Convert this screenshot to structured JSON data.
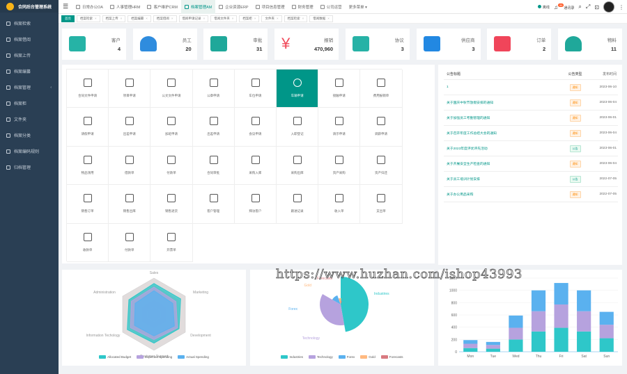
{
  "app": {
    "title": "合同后台管理系统"
  },
  "sidebar": {
    "items": [
      {
        "label": "档案检索",
        "arrow": ""
      },
      {
        "label": "档案借阅",
        "arrow": ""
      },
      {
        "label": "档案上传",
        "arrow": ""
      },
      {
        "label": "档案编纂",
        "arrow": ""
      },
      {
        "label": "档案管理",
        "arrow": "‹"
      },
      {
        "label": "档案柜",
        "arrow": ""
      },
      {
        "label": "文件夹",
        "arrow": ""
      },
      {
        "label": "档案分类",
        "arrow": ""
      },
      {
        "label": "档案编码规则",
        "arrow": ""
      },
      {
        "label": "归档管理",
        "arrow": ""
      }
    ]
  },
  "topbar": {
    "modules": [
      "日常办公OA",
      "人事管理HRM",
      "客户维护CRM",
      "档案管理AM",
      "企业资源ERP",
      "项目信息管理",
      "财务管理",
      "公司运营"
    ],
    "more": "更多菜单 ▾",
    "user_status": "离线",
    "notify_label": "通讯录",
    "notify_count": "99"
  },
  "tabs": [
    "首页",
    "档案检索",
    "档案上传",
    "档案编纂",
    "档案借阅",
    "借阅申请记录",
    "借阅文件夹",
    "档案柜",
    "文件夹",
    "档案检索",
    "借阅数据"
  ],
  "stats": [
    {
      "label": "客户",
      "value": "4",
      "color": "#26b3a6",
      "icon": "users-icon"
    },
    {
      "label": "员工",
      "value": "20",
      "color": "#2f8cde",
      "icon": "user-icon"
    },
    {
      "label": "审批",
      "value": "31",
      "color": "#1fa89a",
      "icon": "card-icon"
    },
    {
      "label": "报销",
      "value": "470,960",
      "color": "#f04b5b",
      "icon": "yen-icon"
    },
    {
      "label": "协议",
      "value": "3",
      "color": "#27b2a6",
      "icon": "contract-icon"
    },
    {
      "label": "供应商",
      "value": "3",
      "color": "#2288e2",
      "icon": "supplier-icon"
    },
    {
      "label": "订单",
      "value": "2",
      "color": "#f0455a",
      "icon": "calendar-icon"
    },
    {
      "label": "物料",
      "value": "11",
      "color": "#1fa89a",
      "icon": "gauge-icon"
    }
  ],
  "grid": [
    "合同文件申请",
    "项目申请",
    "公文文件申请",
    "公章申请",
    "车位申请",
    "车辆申请",
    "接触申请",
    "费用报销单",
    "请假申请",
    "出差申请",
    "加班申请",
    "出差申请",
    "会议申请",
    "入职登记",
    "请示申请",
    "调薪申请",
    "物品领用",
    "借款单",
    "付款单",
    "合同审批",
    "采购入库",
    "采购出库",
    "资产采购",
    "资产归还",
    "销售订单",
    "销售出库",
    "销售退货",
    "客户管理",
    "拜访客户",
    "跟进记录",
    "收入单",
    "支出单",
    "收款单",
    "付款单",
    "开票单"
  ],
  "notice": {
    "headers": [
      "公告标题",
      "公告类型",
      "发布时间"
    ],
    "rows": [
      {
        "title": "1",
        "type": "通知",
        "kind": "o",
        "date": "2023-06-10"
      },
      {
        "title": "关于国庆中秋节放假安排的通知",
        "type": "通知",
        "kind": "o",
        "date": "2023-06-04"
      },
      {
        "title": "关于加强员工考勤管理的通知",
        "type": "通知",
        "kind": "o",
        "date": "2023-06-01"
      },
      {
        "title": "关于召开年度工作总结大会的通知",
        "type": "通知",
        "kind": "o",
        "date": "2023-06-04"
      },
      {
        "title": "关于2023年度评优评先活动",
        "type": "公告",
        "kind": "g",
        "date": "2023-06-01"
      },
      {
        "title": "关于开展安全生产检查的通知",
        "type": "通知",
        "kind": "o",
        "date": "2023-06-04"
      },
      {
        "title": "关于员工培训计划安排",
        "type": "公告",
        "kind": "g",
        "date": "2022-07-05"
      },
      {
        "title": "关于办公用品采购",
        "type": "通知",
        "kind": "o",
        "date": "2022-07-05"
      }
    ]
  },
  "watermark": "https://www.huzhan.com/ishop43993",
  "charts": {
    "radar": {
      "indicators": [
        "Sales",
        "Marketing",
        "Development",
        "Customer Support",
        "Information Techology",
        "Administration"
      ],
      "legend": [
        "Allocated Budget",
        "Expected Spending",
        "Actual Spending"
      ],
      "colors": [
        "#2ec7c9",
        "#b6a2de",
        "#5ab1ef"
      ]
    },
    "rose": {
      "labels": [
        "Industries",
        "Technology",
        "Forex",
        "Gold",
        "Forecasts"
      ],
      "colors": [
        "#2ec7c9",
        "#b6a2de",
        "#5ab1ef",
        "#ffb980",
        "#d87a80"
      ]
    }
  },
  "chart_data": {
    "type": "bar",
    "categories": [
      "Mon",
      "Tue",
      "Wed",
      "Thu",
      "Fri",
      "Sat",
      "Sun"
    ],
    "series": [
      {
        "values": [
          60,
          50,
          200,
          330,
          390,
          330,
          220
        ]
      },
      {
        "values": [
          70,
          60,
          190,
          330,
          380,
          330,
          220
        ]
      },
      {
        "values": [
          60,
          50,
          200,
          340,
          350,
          340,
          210
        ]
      }
    ],
    "colors": [
      "#2ec7c9",
      "#b6a2de",
      "#5ab1ef"
    ],
    "ylim": [
      0,
      1200
    ],
    "yticks": [
      0,
      200,
      400,
      600,
      800,
      1000,
      1200
    ]
  }
}
